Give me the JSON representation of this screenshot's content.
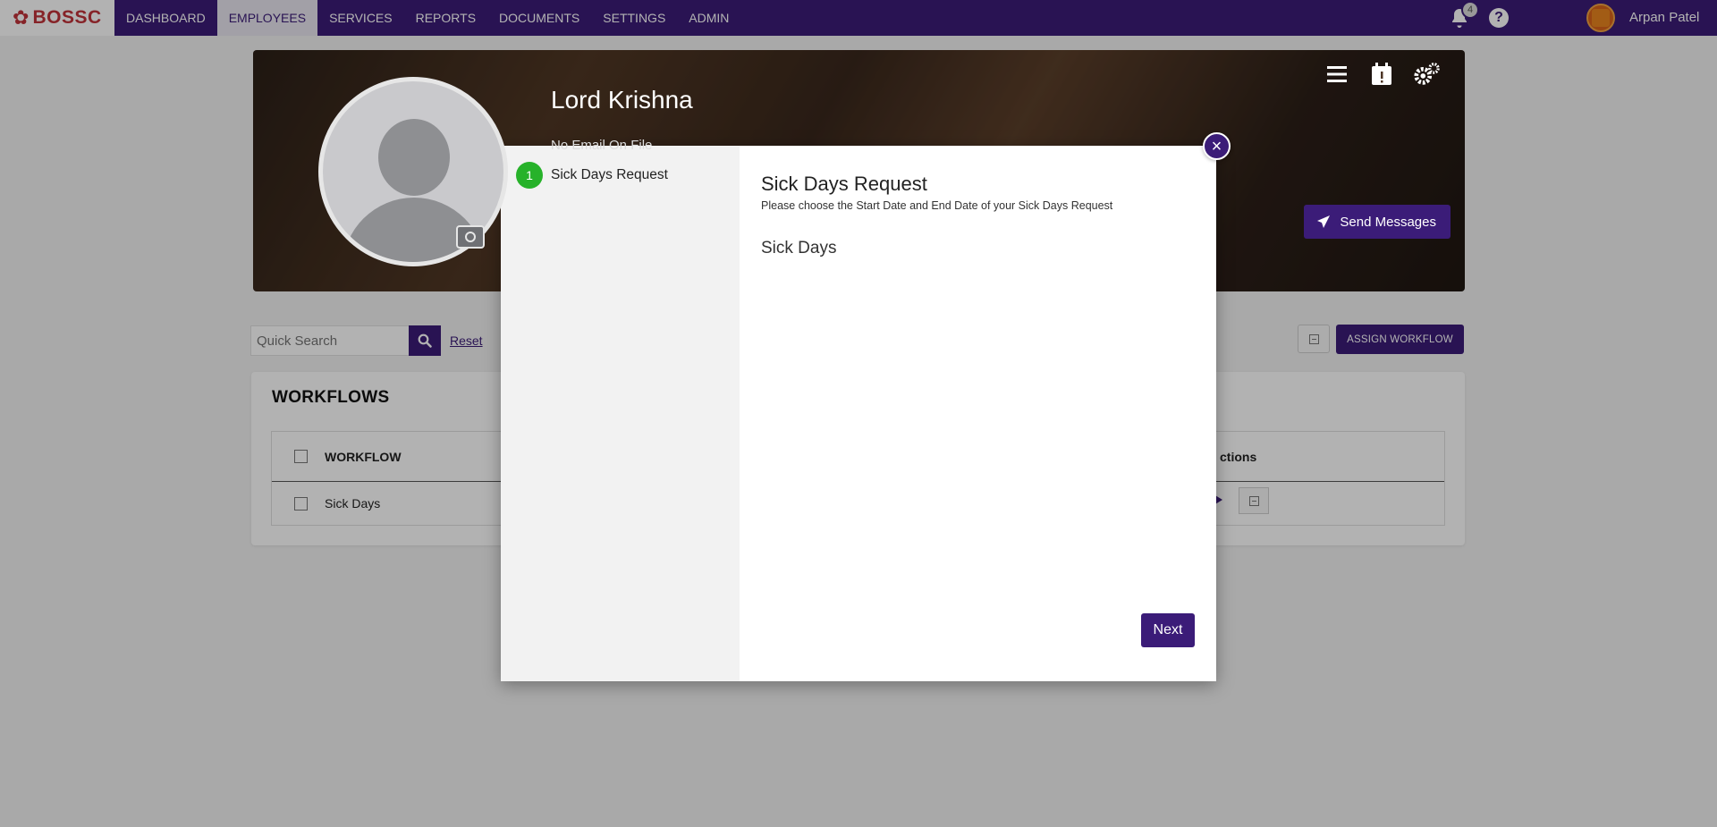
{
  "brand": {
    "logo_text": "BOSSC",
    "color": "#c0333a"
  },
  "nav": {
    "items": [
      {
        "label": "DASHBOARD",
        "active": false
      },
      {
        "label": "EMPLOYEES",
        "active": true
      },
      {
        "label": "SERVICES",
        "active": false
      },
      {
        "label": "REPORTS",
        "active": false
      },
      {
        "label": "DOCUMENTS",
        "active": false
      },
      {
        "label": "SETTINGS",
        "active": false
      },
      {
        "label": "ADMIN",
        "active": false
      }
    ],
    "notifications_count": "4",
    "help_glyph": "?",
    "user_name": "Arpan Patel",
    "accent": "#3b1c78"
  },
  "profile": {
    "name": "Lord Krishna",
    "email_status": "No Email On File",
    "send_messages_label": "Send Messages"
  },
  "search": {
    "placeholder": "Quick Search",
    "reset_label": "Reset",
    "assign_workflow_label": "ASSIGN WORKFLOW"
  },
  "workflows": {
    "title": "WORKFLOWS",
    "columns": {
      "workflow": "WORKFLOW",
      "actions": "ctions"
    },
    "rows": [
      {
        "workflow": "Sick Days"
      }
    ]
  },
  "modal": {
    "steps": [
      {
        "number": "1",
        "label": "Sick Days Request",
        "status_color": "#27b22a"
      }
    ],
    "title": "Sick Days Request",
    "subtitle": "Please choose the Start Date and End Date of your Sick Days Request",
    "section": "Sick Days",
    "next_label": "Next",
    "close_glyph": "×"
  }
}
